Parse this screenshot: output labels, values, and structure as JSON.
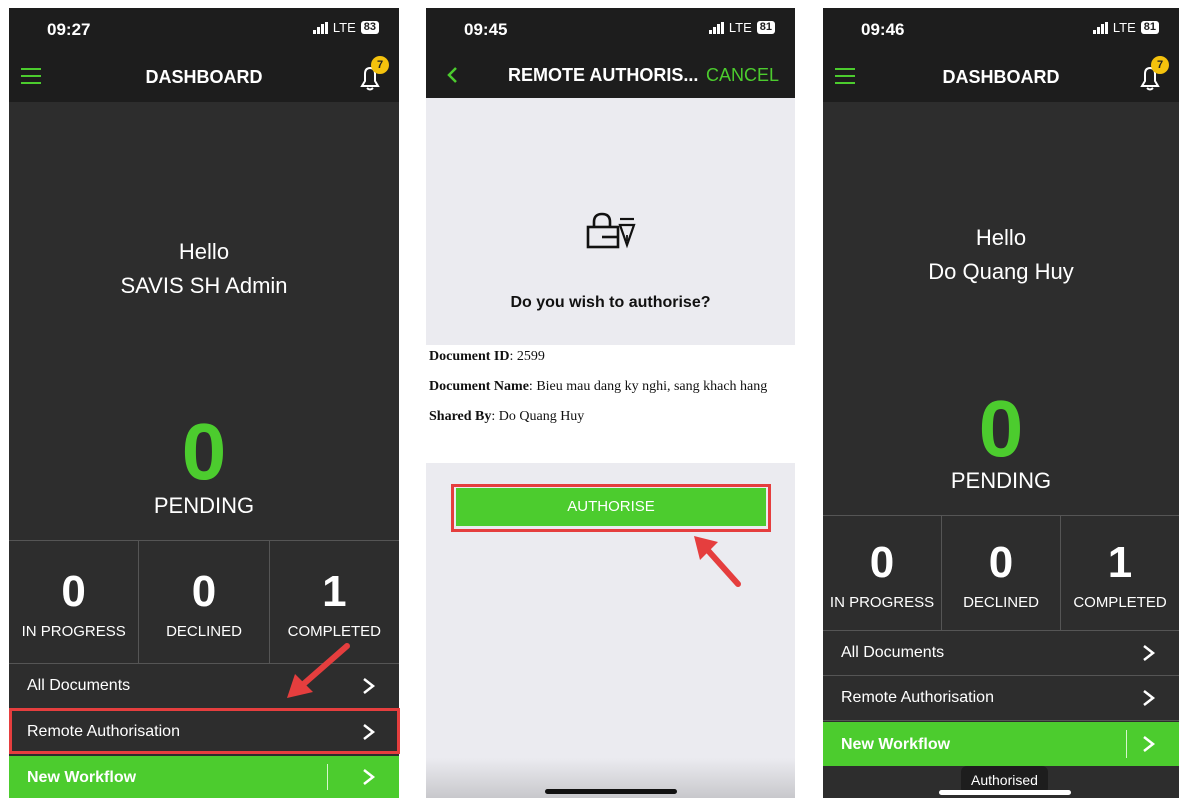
{
  "colors": {
    "accent": "#4ccc2e",
    "dark_bg": "#2d2d2d",
    "bar_bg": "#1d1d1d",
    "highlight": "#e53e3e",
    "badge": "#f4c20d"
  },
  "screen1": {
    "time": "09:27",
    "network": "LTE",
    "battery": "83",
    "title": "DASHBOARD",
    "bell_count": "7",
    "hello": "Hello",
    "user": "SAVIS SH Admin",
    "pending_count": "0",
    "pending_label": "PENDING",
    "stats": [
      {
        "count": "0",
        "label": "IN PROGRESS"
      },
      {
        "count": "0",
        "label": "DECLINED"
      },
      {
        "count": "1",
        "label": "COMPLETED"
      }
    ],
    "all_documents": "All Documents",
    "remote_authorisation": "Remote Authorisation",
    "new_workflow": "New Workflow"
  },
  "screen2": {
    "time": "09:45",
    "network": "LTE",
    "battery": "81",
    "title": "REMOTE AUTHORIS...",
    "cancel": "CANCEL",
    "question": "Do you wish to authorise?",
    "doc_id_label": "Document ID",
    "doc_id": "2599",
    "doc_name_label": "Document Name",
    "doc_name": "Bieu mau dang ky nghi, sang khach hang",
    "shared_by_label": "Shared By",
    "shared_by": "Do Quang Huy",
    "authorise": "AUTHORISE"
  },
  "screen3": {
    "time": "09:46",
    "network": "LTE",
    "battery": "81",
    "title": "DASHBOARD",
    "bell_count": "7",
    "hello": "Hello",
    "user": "Do Quang Huy",
    "pending_count": "0",
    "pending_label": "PENDING",
    "stats": [
      {
        "count": "0",
        "label": "IN PROGRESS"
      },
      {
        "count": "0",
        "label": "DECLINED"
      },
      {
        "count": "1",
        "label": "COMPLETED"
      }
    ],
    "all_documents": "All Documents",
    "remote_authorisation": "Remote Authorisation",
    "new_workflow": "New Workflow",
    "toast": "Authorised"
  }
}
